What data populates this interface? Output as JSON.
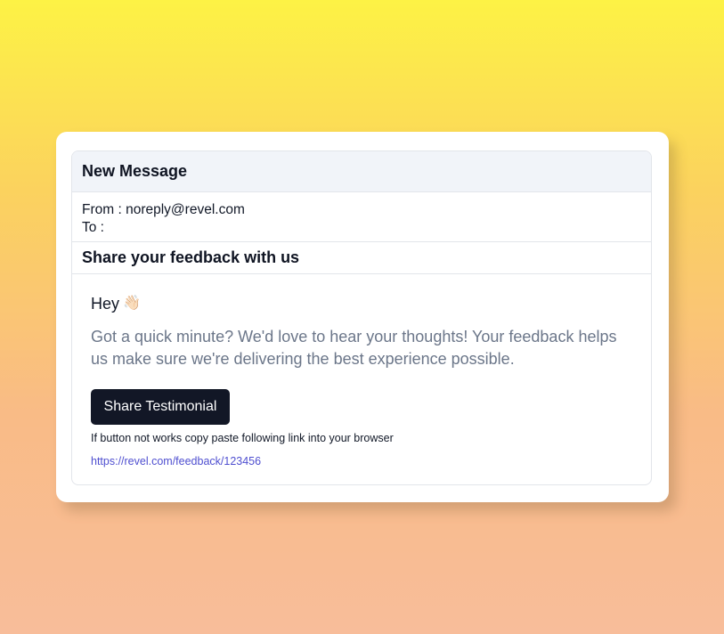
{
  "email": {
    "window_title": "New Message",
    "from_label": "From : ",
    "from_value": "noreply@revel.com",
    "to_label": "To :",
    "to_value": "",
    "subject": "Share your feedback with us",
    "greeting": "Hey",
    "greeting_emoji": "👋🏻",
    "body_text": "Got a quick minute? We'd love to hear your thoughts! Your feedback helps us make sure we're delivering the best experience possible.",
    "button_label": "Share Testimonial",
    "fallback_hint": "If button not works copy paste following link into your browser",
    "fallback_link": "https://revel.com/feedback/123456"
  },
  "colors": {
    "button_bg": "#121726",
    "link": "#4f4fd0",
    "body_text": "#6b7689",
    "header_bg": "#f1f4f9"
  }
}
